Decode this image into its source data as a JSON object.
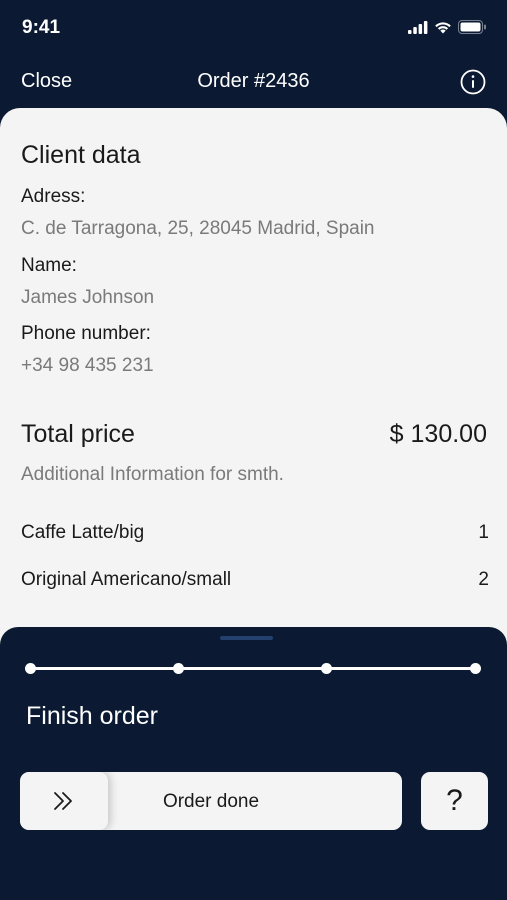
{
  "status_bar": {
    "time": "9:41",
    "icons": [
      "signal-icon",
      "wifi-icon",
      "battery-icon"
    ]
  },
  "nav": {
    "close_label": "Close",
    "title": "Order #2436",
    "info_icon": "info-icon"
  },
  "client": {
    "section_title": "Client data",
    "address_label": "Adress:",
    "address_value": "C. de Tarragona, 25, 28045 Madrid, Spain",
    "name_label": "Name:",
    "name_value": "James Johnson",
    "phone_label": "Phone number:",
    "phone_value": "+34 98 435 231"
  },
  "total": {
    "label": "Total price",
    "value": "$ 130.00",
    "additional_info": "Additional Information for smth."
  },
  "items": [
    {
      "name": "Caffe Latte/big",
      "qty": "1"
    },
    {
      "name": "Original Americano/small",
      "qty": "2"
    }
  ],
  "finish": {
    "title": "Finish order",
    "progress_steps": 4,
    "slider_label": "Order done",
    "slider_handle_icon": "double-chevron-right-icon",
    "help_label": "?"
  },
  "colors": {
    "background": "#0b1a32",
    "sheet": "#f4f4f4",
    "text_primary": "#1a1a1a",
    "text_secondary": "#7a7a7a",
    "accent_handle": "#23406e"
  }
}
